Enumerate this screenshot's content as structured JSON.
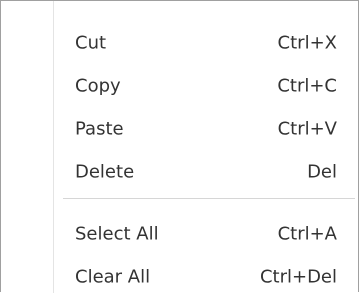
{
  "menu": {
    "items": [
      {
        "label": "Cut",
        "shortcut": "Ctrl+X"
      },
      {
        "label": "Copy",
        "shortcut": "Ctrl+C"
      },
      {
        "label": "Paste",
        "shortcut": "Ctrl+V"
      },
      {
        "label": "Delete",
        "shortcut": "Del"
      },
      {
        "label": "Select All",
        "shortcut": "Ctrl+A"
      },
      {
        "label": "Clear All",
        "shortcut": "Ctrl+Del"
      }
    ]
  }
}
